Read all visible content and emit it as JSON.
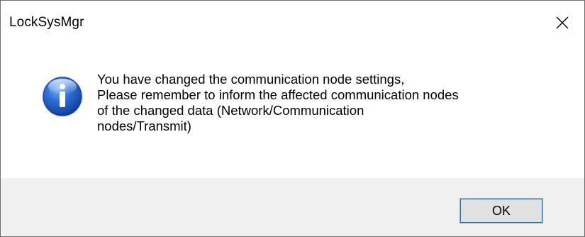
{
  "window": {
    "title": "LockSysMgr",
    "close_icon": "close-icon"
  },
  "message": {
    "icon": "info-icon",
    "text": "You have changed the communication node settings,\nPlease remember to inform the affected communication nodes\nof the changed data (Network/Communication\nnodes/Transmit)"
  },
  "buttons": {
    "ok_label": "OK"
  },
  "colors": {
    "footer_background": "#f0f0f0",
    "button_focus": "#0078d7",
    "button_face": "#e1e1e1",
    "icon_blue": "#1f5fc4"
  }
}
